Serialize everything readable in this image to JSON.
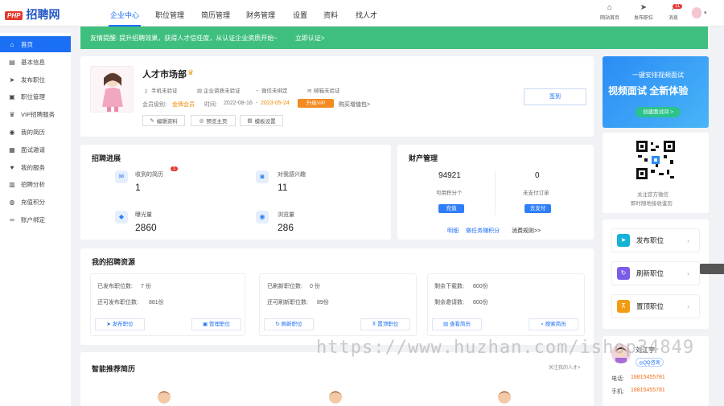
{
  "logo": {
    "badge": "PHP",
    "text": "招聘网"
  },
  "nav": {
    "items": [
      "企业中心",
      "职位管理",
      "简历管理",
      "财务管理",
      "设置",
      "资料",
      "找人才"
    ],
    "active_index": 0
  },
  "top_icons": [
    {
      "label": "网站首页",
      "icon": "home-icon"
    },
    {
      "label": "发布职位",
      "icon": "send-icon"
    },
    {
      "label": "消息",
      "icon": "bell-icon",
      "badge": "11"
    }
  ],
  "sidebar": {
    "items": [
      {
        "label": "首页",
        "icon": "home-icon"
      },
      {
        "label": "基本信息",
        "icon": "document-icon"
      },
      {
        "label": "发布职位",
        "icon": "send-icon"
      },
      {
        "label": "职位管理",
        "icon": "briefcase-icon"
      },
      {
        "label": "VIP招聘服务",
        "icon": "crown-icon"
      },
      {
        "label": "我的简历",
        "icon": "user-icon"
      },
      {
        "label": "面试邀请",
        "icon": "calendar-icon"
      },
      {
        "label": "我的服务",
        "icon": "heart-icon"
      },
      {
        "label": "招聘分析",
        "icon": "chart-icon"
      },
      {
        "label": "充值积分",
        "icon": "coin-icon"
      },
      {
        "label": "账户绑定",
        "icon": "link-icon"
      }
    ],
    "active_index": 0
  },
  "banner": {
    "label": "友情提醒:",
    "text": "提升招聘效果，获得人才信任度，从认证企业资质开始~",
    "link": "立即认证>"
  },
  "company": {
    "name": "人才市场部",
    "verifications": [
      "手机未验证",
      "企业资质未验证",
      "微信未绑定",
      "邮箱未验证"
    ],
    "level_label": "会员级别:",
    "level_value": "金牌会员",
    "time_label": "时间:",
    "time_start": "2022-08-16",
    "time_sep": "-",
    "time_end": "2023-05-24",
    "upgrade_button": "升级VIP",
    "buy_more": "购买增值包>",
    "actions": [
      "编辑资料",
      "预览主页",
      "模板设置"
    ],
    "signin_button": "签到"
  },
  "recruit": {
    "title": "招聘进展",
    "stats": [
      {
        "label": "收到的简历",
        "value": "1",
        "badge": "1",
        "icon": "inbox-icon"
      },
      {
        "label": "对我感兴趣",
        "value": "11",
        "icon": "chat-icon"
      },
      {
        "label": "曝光量",
        "value": "2860",
        "icon": "tag-icon"
      },
      {
        "label": "浏览量",
        "value": "286",
        "icon": "eye-icon"
      }
    ]
  },
  "finance": {
    "title": "财产管理",
    "points_value": "94921",
    "points_label": "可用积分个",
    "points_button": "充值",
    "orders_value": "0",
    "orders_label": "未支付订单",
    "orders_button": "去支付",
    "links": [
      "明细",
      "做任务赚积分",
      "消费规则>>"
    ]
  },
  "resources": {
    "title": "我的招聘资源",
    "columns": [
      {
        "lines": [
          {
            "label": "已发布职位数:",
            "value": "7 份"
          },
          {
            "label": "还可发布职位数:",
            "value": "881份"
          }
        ],
        "buttons": [
          {
            "label": "发布职位",
            "icon": "send-icon"
          },
          {
            "label": "管理职位",
            "icon": "briefcase-icon"
          }
        ]
      },
      {
        "lines": [
          {
            "label": "已刷新职位数:",
            "value": "0 份"
          },
          {
            "label": "还可刷新职位数:",
            "value": "89份"
          }
        ],
        "buttons": [
          {
            "label": "刷新职位",
            "icon": "refresh-icon"
          },
          {
            "label": "置顶职位",
            "icon": "pin-icon"
          }
        ]
      },
      {
        "lines": [
          {
            "label": "剩余下载数:",
            "value": "800份"
          },
          {
            "label": "剩余邀请数:",
            "value": "800份"
          }
        ],
        "buttons": [
          {
            "label": "查看简历",
            "icon": "document-icon"
          },
          {
            "label": "搜索简历",
            "icon": "search-icon"
          }
        ]
      }
    ]
  },
  "recommend": {
    "title": "智能推荐简历",
    "link": "关注我的人才>"
  },
  "ad": {
    "line1": "一键安排视频面试",
    "line2": "视频面试 全新体验",
    "button": "创建面试间 >"
  },
  "qr": {
    "line1": "关注官方微信",
    "line2": "即时随地接收鉴历"
  },
  "quick_actions": [
    {
      "label": "发布职位",
      "icon": "send-icon",
      "color": "#12b3d6"
    },
    {
      "label": "刷新职位",
      "icon": "refresh-icon",
      "color": "#7c5ce6"
    },
    {
      "label": "置顶职位",
      "icon": "pin-icon",
      "color": "#f29c12"
    }
  ],
  "contact": {
    "name": "刘江宇",
    "qq": "QQ咨询",
    "phone_label": "电话:",
    "phone": "18815455781",
    "mobile_label": "手机:",
    "mobile": "18815455781"
  },
  "watermark": "https://www.huzhan.com/ishop34849"
}
